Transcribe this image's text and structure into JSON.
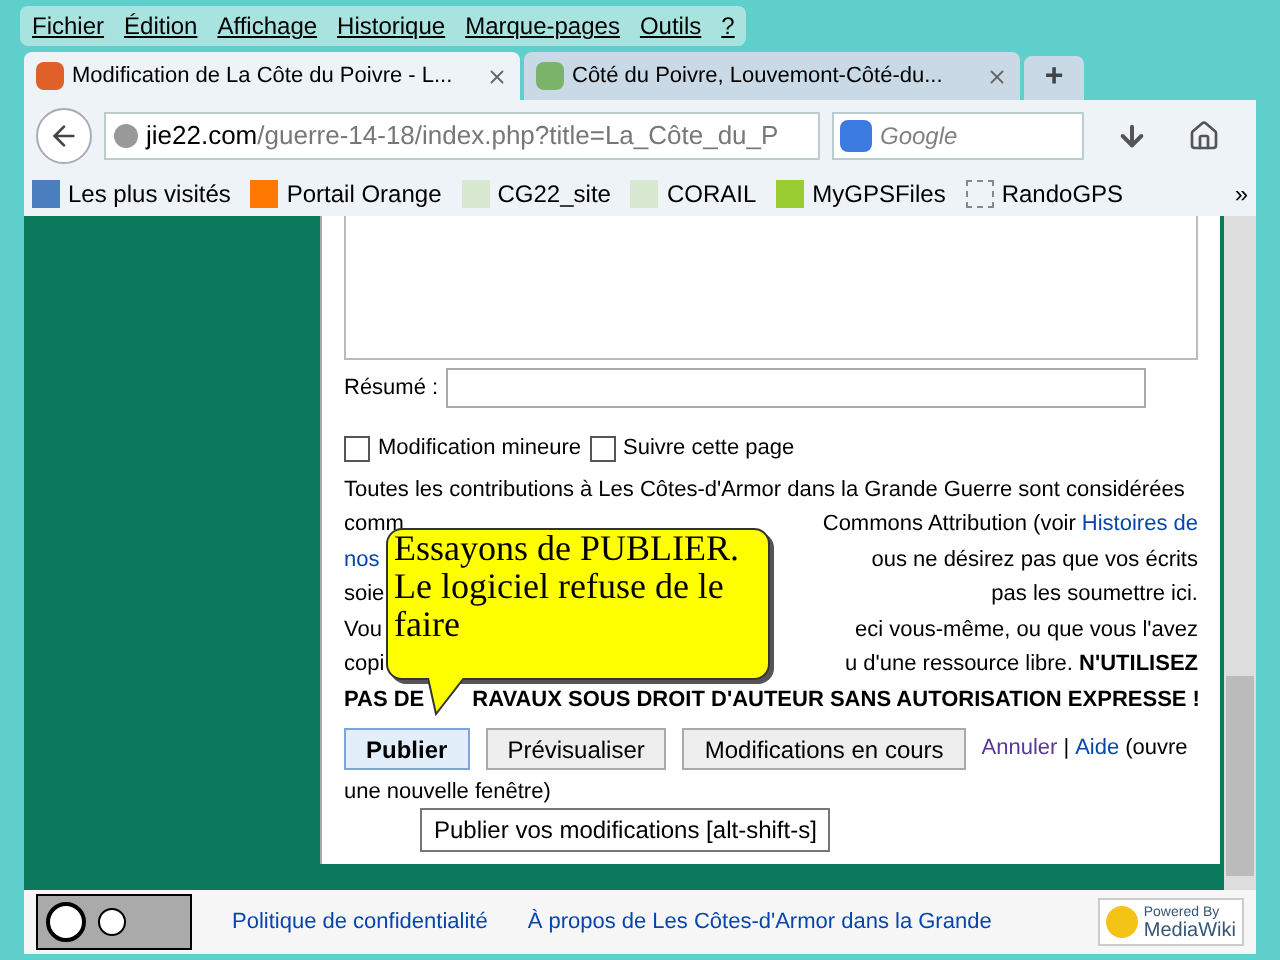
{
  "menu": [
    "Fichier",
    "Édition",
    "Affichage",
    "Historique",
    "Marque-pages",
    "Outils",
    "?"
  ],
  "tabs": [
    {
      "label": "Modification de La Côte du Poivre - L...",
      "selected": true
    },
    {
      "label": "Côté du Poivre, Louvemont-Côté-du...",
      "selected": false
    }
  ],
  "new_tab": "+",
  "url": {
    "domain": "jie22.com",
    "path": "/guerre-14-18/index.php?title=La_Côte_du_P"
  },
  "search": {
    "placeholder": "Google"
  },
  "bookmarks": [
    "Les plus visités",
    "Portail Orange",
    "CG22_site",
    "CORAIL",
    "MyGPSFiles",
    "RandoGPS"
  ],
  "bookmarks_more": "»",
  "form": {
    "summary_label": "Résumé :",
    "checkboxes": [
      {
        "label": "Modification mineure",
        "checked": false
      },
      {
        "label": "Suivre cette page",
        "checked": false
      }
    ],
    "notice": [
      {
        "left": "Toutes les contributions à Les Côtes-d'Armor dans la Grande Guerre sont considérées"
      },
      {
        "left": "comm",
        "right": "Commons Attribution (voir ",
        "link": "Histoires de"
      },
      {
        "left_link": "nos",
        "right": "ous ne désirez pas que vos écrits"
      },
      {
        "left": "soie",
        "right": "pas les soumettre ici."
      },
      {
        "left": "Vou",
        "right": "eci vous-même, ou que vous l'avez"
      },
      {
        "left": "copi",
        "right": "u d'une ressource libre. ",
        "bold": "N'UTILISEZ"
      },
      {
        "left_bold": "PAS DE",
        "right_bold": "RAVAUX SOUS DROIT D'AUTEUR SANS AUTORISATION EXPRESSE !"
      }
    ],
    "buttons": [
      {
        "label": "Publier",
        "selected": true
      },
      {
        "label": "Prévisualiser",
        "selected": false
      },
      {
        "label": "Modifications en cours",
        "selected": false
      }
    ],
    "cancel": "Annuler",
    "sep": "|",
    "help": "Aide",
    "help_note": "(ouvre",
    "help_note2": "une nouvelle fenêtre)",
    "tooltip": "Publier vos modifications [alt-shift-s]"
  },
  "callout": [
    "Essayons de PUBLIER.",
    "Le logiciel refuse de le",
    "faire"
  ],
  "footer": {
    "links": [
      "Politique de confidentialité",
      "À propos de Les Côtes-d'Armor dans la Grande"
    ],
    "powered": [
      "Powered By",
      "MediaWiki"
    ]
  }
}
